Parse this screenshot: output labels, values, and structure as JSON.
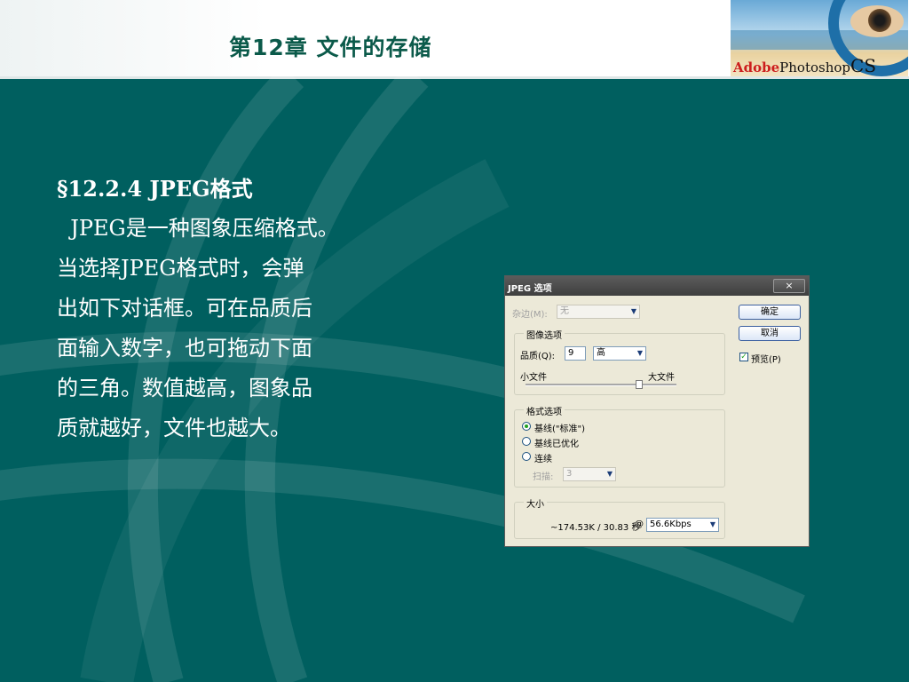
{
  "header": {
    "chapter_title": "第12章 文件的存储",
    "logo": {
      "adobe": "Adobe",
      "photoshop": "Photoshop",
      "cs": "CS"
    }
  },
  "slide": {
    "section_heading": "§12.2.4  JPEG格式",
    "body_lines": [
      "  JPEG是一种图象压缩格式。",
      "当选择JPEG格式时，会弹",
      "出如下对话框。可在品质后",
      "面输入数字，也可拖动下面",
      "的三角。数值越高，图象品",
      "质就越好，文件也越大。"
    ]
  },
  "dialog": {
    "title": "JPEG 选项",
    "close_label": "×",
    "matte_label": "杂边(M):",
    "matte_value": "无",
    "image_options_title": "图像选项",
    "quality_label": "品质(Q):",
    "quality_value": "9",
    "quality_level": "高",
    "small_file": "小文件",
    "large_file": "大文件",
    "ok": "确定",
    "cancel": "取消",
    "preview": "预览(P)",
    "format_options_title": "格式选项",
    "baseline_standard": "基线(\"标准\")",
    "baseline_optimized": "基线已优化",
    "progressive": "连续",
    "scans_label": "扫描:",
    "scans_value": "3",
    "size_title": "大小",
    "size_value": "~174.53K / 30.83 秒",
    "at": "@",
    "speed": "56.6Kbps",
    "quality_slider_fraction": 0.75
  }
}
